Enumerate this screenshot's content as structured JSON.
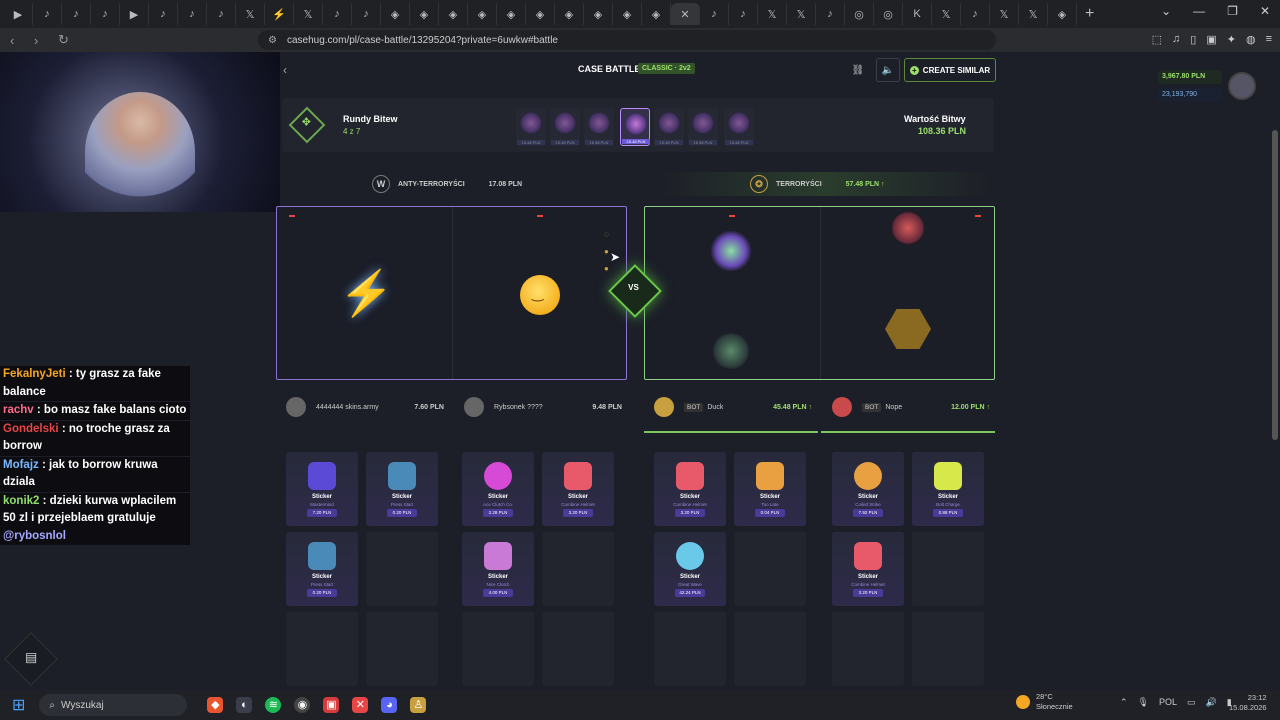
{
  "browser": {
    "url": "casehug.com/pl/case-battle/13295204?private=6uwkw#battle",
    "tab_count_label": "+"
  },
  "battle": {
    "header_title": "CASE BATTLE",
    "mode_badge": "CLASSIC · 2v2",
    "create_similar": "CREATE SIMILAR",
    "rounds_title": "Rundy Bitew",
    "rounds_progress": "4 z 7",
    "battle_value_label": "Wartość Bitwy",
    "battle_value": "108.36 PLN",
    "case_prices": [
      "15.48 PLN",
      "15.48 PLN",
      "15.48 PLN",
      "15.48 PLN",
      "15.48 PLN",
      "15.48 PLN",
      "15.48 PLN"
    ],
    "active_round": 4,
    "vs_label": "VS"
  },
  "teams": {
    "ct": {
      "name": "ANTY-TERRORYŚCI",
      "value": "17.08 PLN"
    },
    "t": {
      "name": "TERRORYŚCI",
      "value": "57.48 PLN ↑"
    }
  },
  "players": [
    {
      "name": "4444444 skins.army",
      "value": "7.60 PLN",
      "bot": ""
    },
    {
      "name": "Rybsonek ????",
      "value": "9.48 PLN",
      "bot": ""
    },
    {
      "name": "Duck",
      "value": "45.48 PLN ↑",
      "bot": "BOT"
    },
    {
      "name": "Nope",
      "value": "12.00 PLN ↑",
      "bot": "BOT"
    }
  ],
  "cards": [
    {
      "name": "Sticker",
      "sub": "Mastermind",
      "price": "7.20 PLN",
      "color": "#5a4ad6"
    },
    {
      "name": "Sticker",
      "sub": "Press Start",
      "price": "0.20 PLN",
      "color": "#4a8ab8"
    },
    {
      "name": "Sticker",
      "sub": "Press Start",
      "price": "0.20 PLN",
      "color": "#4a8ab8"
    },
    {
      "name": "Sticker",
      "sub": "Ace Clutch Co.",
      "price": "2.28 PLN",
      "color": "#d64ad6"
    },
    {
      "name": "Sticker",
      "sub": "Combine Helmet",
      "price": "3.20 PLN",
      "color": "#e85a6a"
    },
    {
      "name": "Sticker",
      "sub": "Nice Clutch",
      "price": "4.00 PLN",
      "color": "#c87ad6"
    },
    {
      "name": "Sticker",
      "sub": "Combine Helmet",
      "price": "3.20 PLN",
      "color": "#e85a6a"
    },
    {
      "name": "Sticker",
      "sub": "Too Late",
      "price": "0.04 PLN",
      "color": "#e8a040"
    },
    {
      "name": "Sticker",
      "sub": "Great Wave",
      "price": "42.24 PLN",
      "color": "#6ac8e8"
    },
    {
      "name": "Sticker",
      "sub": "Coiled Strike",
      "price": "7.92 PLN",
      "color": "#e8a040"
    },
    {
      "name": "Sticker",
      "sub": "Bolt Charge",
      "price": "0.88 PLN",
      "color": "#d6e84a"
    },
    {
      "name": "Sticker",
      "sub": "Combine Helmet",
      "price": "3.20 PLN",
      "color": "#e85a6a"
    }
  ],
  "wallet": {
    "balance": "3,967.80 PLN",
    "coins": "23,193,790"
  },
  "chat": [
    {
      "user": "FekalnyJeti",
      "msg": ": ty grasz za fake balance"
    },
    {
      "user": "rachv",
      "msg": ": bo masz fake balans cioto"
    },
    {
      "user": "Gondelski",
      "msg": ": no troche grasz za borrow"
    },
    {
      "user": "Mofajz",
      "msg": ": jak to borrow kruwa dziala"
    },
    {
      "user": "konik2",
      "msg": ": dzieki kurwa wplacilem 50 zl i przejeblaem gratuluje",
      "mention": "@rybosnlol"
    }
  ],
  "taskbar": {
    "search_placeholder": "Wyszukaj",
    "weather_temp": "28°C",
    "weather_desc": "Słonecznie",
    "lang": "POL",
    "time": "23:12",
    "date": "15.08.2026"
  }
}
